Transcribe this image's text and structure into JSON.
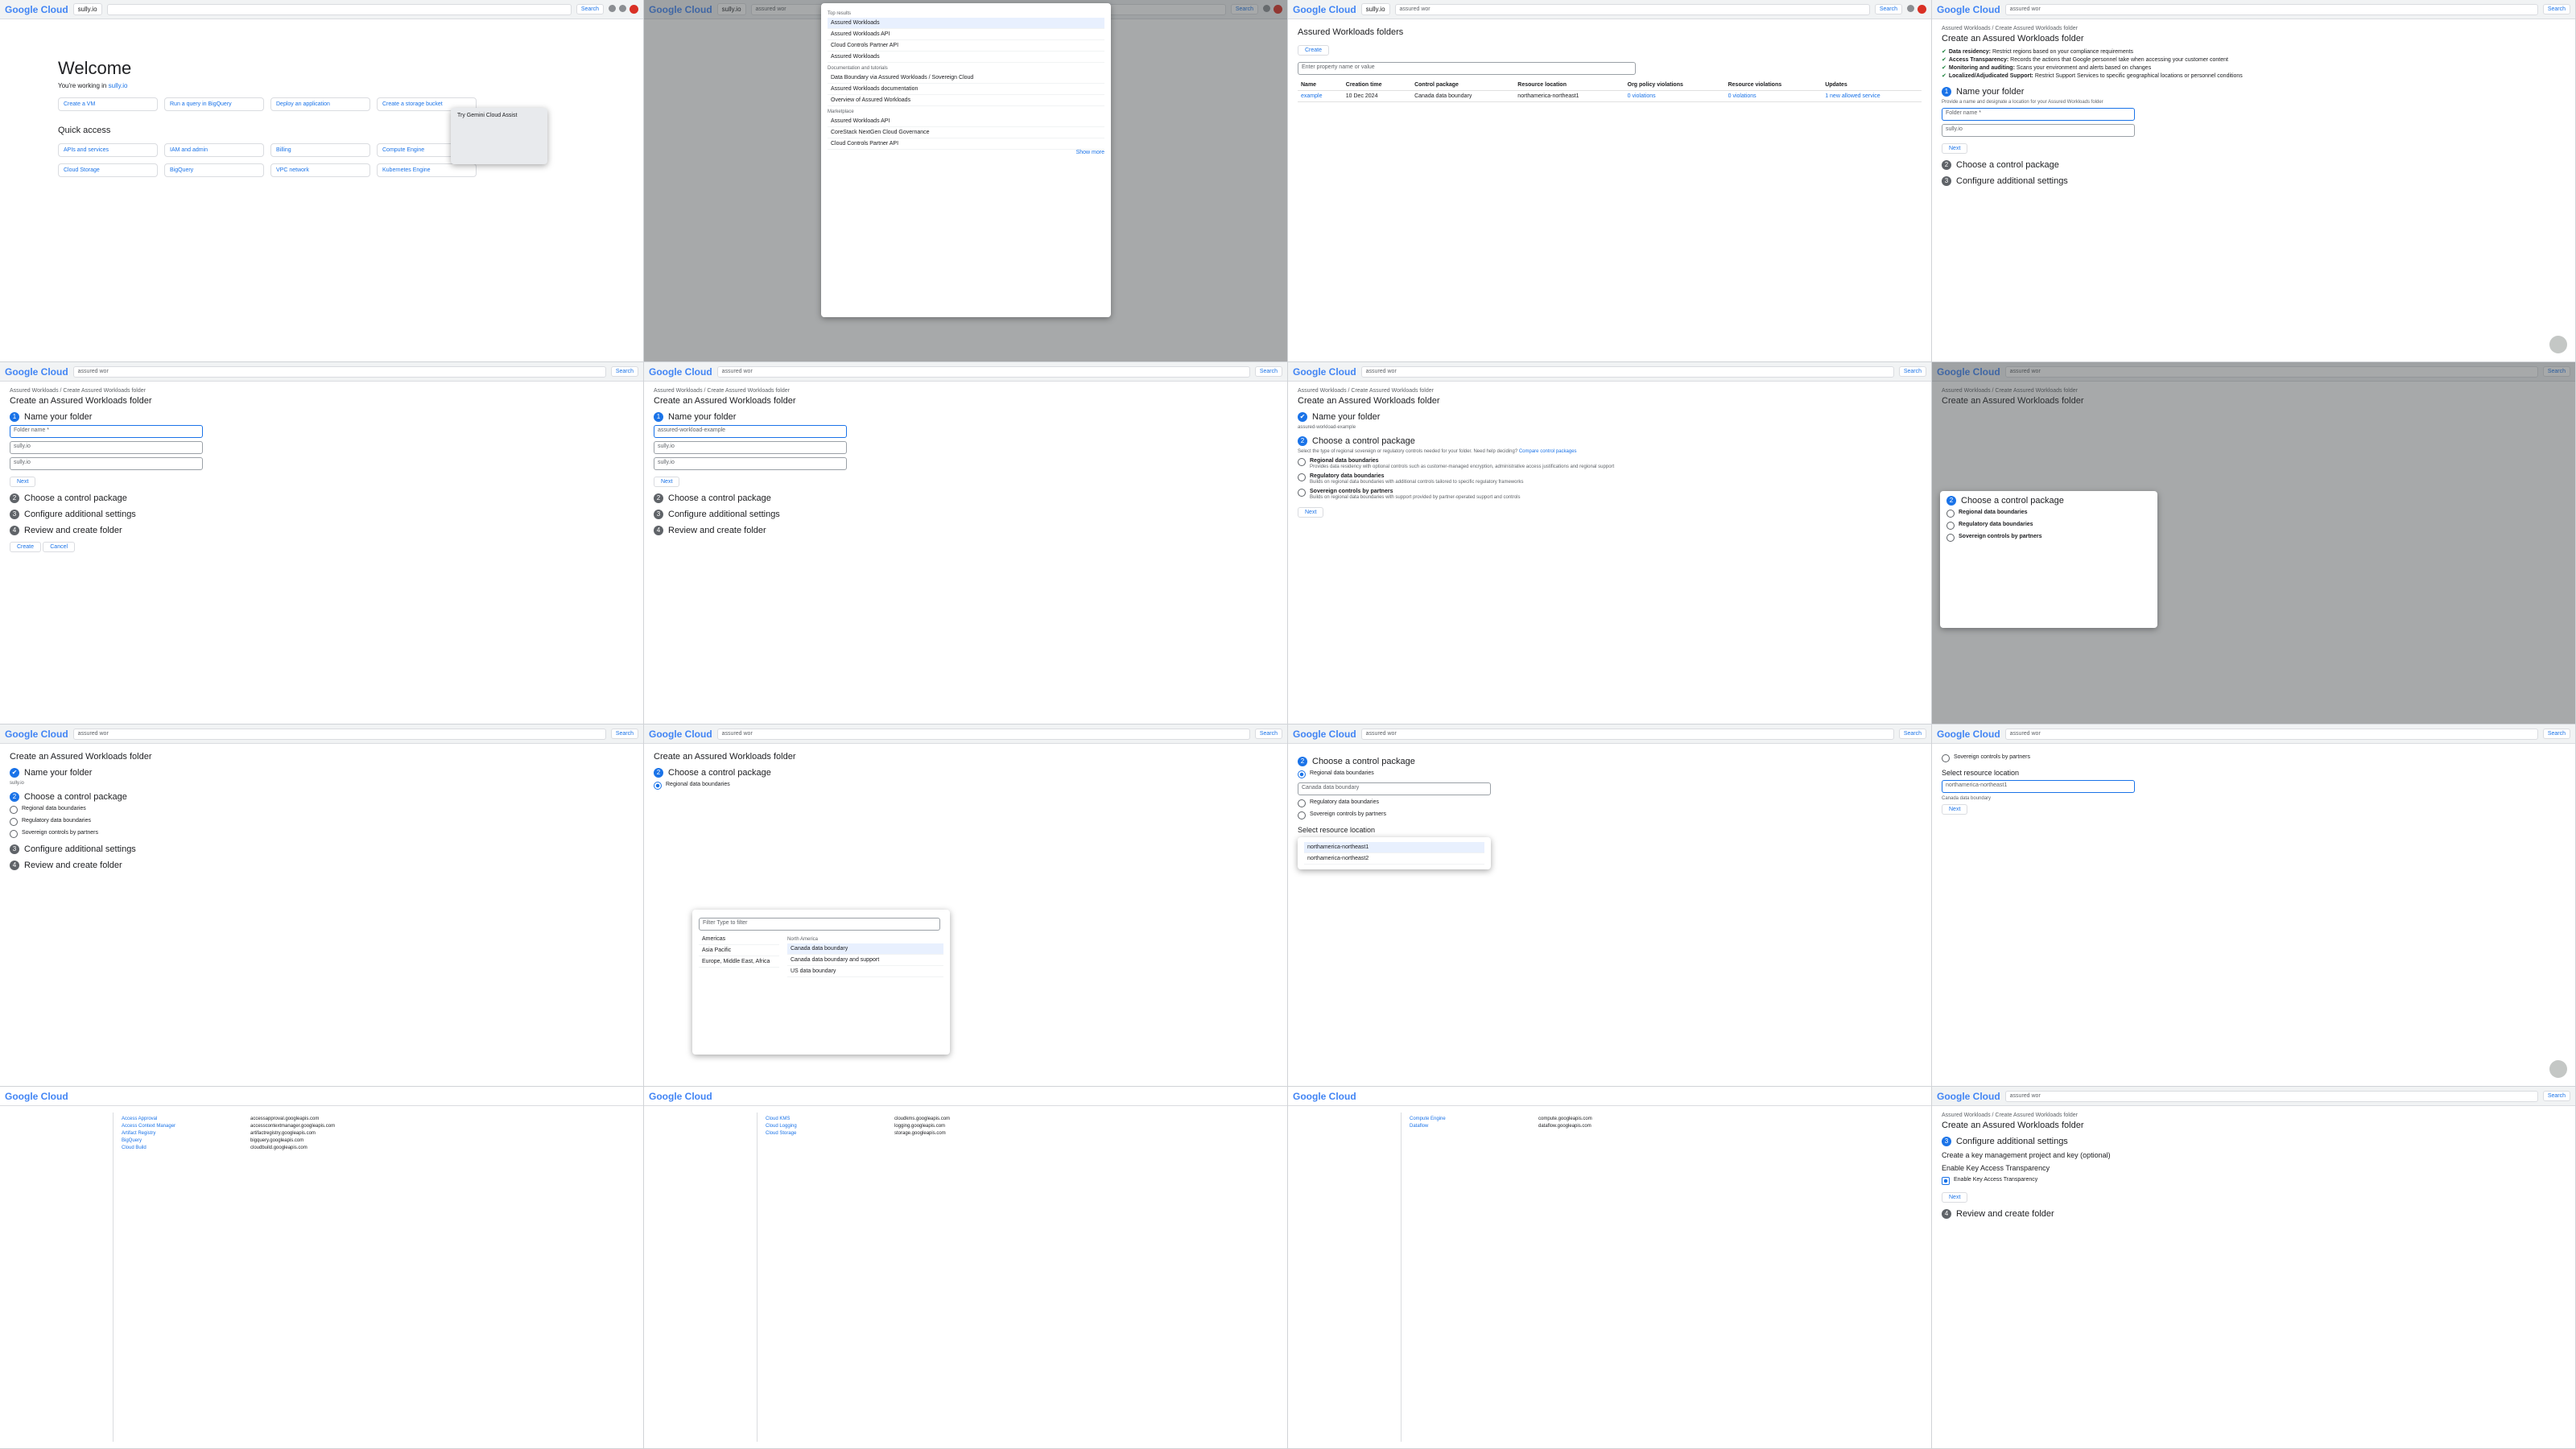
{
  "brand": "Google Cloud",
  "project": "sully.io",
  "search_value": "assured wor",
  "search_button": "Search",
  "breadcrumb": "Assured Workloads  /  Create Assured Workloads folder",
  "page_title": "Create an Assured Workloads folder",
  "requirements": [
    {
      "label": "Data residency:",
      "text": "Restrict regions based on your compliance requirements"
    },
    {
      "label": "Access Transparency:",
      "text": "Records the actions that Google personnel take when accessing your customer content"
    },
    {
      "label": "Monitoring and auditing:",
      "text": "Scans your environment and alerts based on changes"
    },
    {
      "label": "Localized/Adjudicated Support:",
      "text": "Restrict Support Services to specific geographical locations or personnel conditions"
    }
  ],
  "steps": [
    "Name your folder",
    "Choose a control package",
    "Configure additional settings",
    "Review and create folder"
  ],
  "step1": {
    "hint": "Provide a name and designate a location for your Assured Workloads folder",
    "folder_label": "Folder name *",
    "folder_value": "assured-workload-example",
    "org_label": "Organization *",
    "org_value": "sully.io",
    "location_label": "Location *",
    "location_value": "sully.io",
    "next": "Next"
  },
  "summary": {
    "folder_name": "assured-workload-example",
    "organization": "sully.io",
    "folder_location": "sully.io"
  },
  "control": {
    "intro": "Select the type of regional sovereign or regulatory controls needed for your folder. Need help deciding?",
    "link": "Compare control packages",
    "options": [
      {
        "title": "Regional data boundaries",
        "desc": "Provides data residency with optional controls such as customer-managed encryption, administrative access justifications and regional support"
      },
      {
        "title": "Regulatory data boundaries",
        "desc": "Builds on regional data boundaries with additional controls tailored to specific regulatory frameworks"
      },
      {
        "title": "Sovereign controls by partners",
        "desc": "Builds on regional data boundaries with support provided by partner-operated support and controls"
      }
    ]
  },
  "regional_select": "Canada data boundary",
  "resource_location_title": "Select resource location",
  "locations": [
    "northamerica-northeast1",
    "northamerica-northeast2"
  ],
  "create": "Create",
  "cancel": "Cancel",
  "welcome": {
    "title": "Welcome",
    "working_in": "You're working in",
    "tiles": [
      "Create a VM",
      "Run a query in BigQuery",
      "Deploy an application",
      "Create a storage bucket"
    ],
    "quick": "Quick access",
    "quick_items": [
      "APIs and services",
      "IAM and admin",
      "Billing",
      "Compute Engine",
      "Cloud Storage",
      "BigQuery",
      "VPC network",
      "Kubernetes Engine"
    ],
    "gemini": "Try Gemini Cloud Assist"
  },
  "dropdown": {
    "top": "Top results",
    "items": [
      "Assured Workloads",
      "Assured Workloads API",
      "Cloud Controls Partner API",
      "Assured Workloads"
    ],
    "docs": "Documentation and tutorials",
    "doc_items": [
      "Data Boundary via Assured Workloads / Sovereign Cloud",
      "Assured Workloads documentation",
      "Overview of Assured Workloads"
    ],
    "market": "Marketplace",
    "market_items": [
      "Assured Workloads API",
      "CoreStack NextGen Cloud Governance",
      "Cloud Controls Partner API"
    ],
    "show_more": "Show more"
  },
  "folders": {
    "title": "Assured Workloads folders",
    "create": "Create",
    "filter": "Enter property name or value",
    "headers": [
      "Name",
      "Creation time",
      "Control package",
      "Resource location",
      "Org policy violations",
      "Resource violations",
      "Updates"
    ],
    "row": [
      "example",
      "10 Dec 2024",
      "Canada data boundary",
      "northamerica-northeast1",
      "0 violations",
      "0 violations",
      "1 new allowed service"
    ]
  },
  "region_menu": {
    "filter": "Filter  Type to filter",
    "regions": [
      "Americas",
      "Asia Pacific",
      "Europe, Middle East, Africa"
    ],
    "group": "North America",
    "options": [
      "Canada data boundary",
      "Canada data boundary and support",
      "US data boundary"
    ]
  },
  "services": [
    "Access Approval",
    "Access Context Manager",
    "Artifact Registry",
    "BigQuery",
    "Cloud Build",
    "Cloud KMS",
    "Cloud Logging",
    "Cloud Storage",
    "Compute Engine",
    "Dataflow"
  ],
  "apis": [
    "accessapproval.googleapis.com",
    "accesscontextmanager.googleapis.com",
    "artifactregistry.googleapis.com",
    "bigquery.googleapis.com",
    "cloudbuild.googleapis.com",
    "cloudkms.googleapis.com",
    "logging.googleapis.com",
    "storage.googleapis.com",
    "compute.googleapis.com",
    "dataflow.googleapis.com"
  ],
  "additional": {
    "key_mgmt": "Create a key management project and key (optional)",
    "kat": "Enable Key Access Transparency",
    "kat_checkbox": "Enable Key Access Transparency"
  }
}
